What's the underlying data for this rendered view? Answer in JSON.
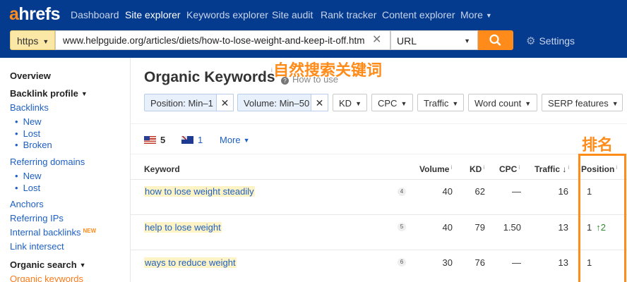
{
  "nav": {
    "logo_a": "a",
    "logo_rest": "hrefs",
    "items": [
      "Dashboard",
      "Site explorer",
      "Keywords explorer",
      "Site audit",
      "Rank tracker",
      "Content explorer",
      "More"
    ],
    "active": "Site explorer"
  },
  "search": {
    "protocol": "https",
    "url": "www.helpguide.org/articles/diets/how-to-lose-weight-and-keep-it-off.htm",
    "mode": "URL",
    "settings_label": "Settings"
  },
  "sidebar": {
    "overview": "Overview",
    "backlink_profile": "Backlink profile",
    "backlinks": "Backlinks",
    "bl_new": "New",
    "bl_lost": "Lost",
    "bl_broken": "Broken",
    "referring_domains": "Referring domains",
    "rd_new": "New",
    "rd_lost": "Lost",
    "anchors": "Anchors",
    "referring_ips": "Referring IPs",
    "internal_backlinks": "Internal backlinks",
    "new_badge": "NEW",
    "link_intersect": "Link intersect",
    "organic_search": "Organic search",
    "organic_keywords": "Organic keywords"
  },
  "main": {
    "title": "Organic Keywords",
    "info_mark": "i",
    "how_to_use": "How to use",
    "annotation_title": "自然搜索关键词",
    "annotation_position": "排名",
    "filters": {
      "position": "Position: Min–1",
      "volume": "Volume: Min–50",
      "kd": "KD",
      "cpc": "CPC",
      "traffic": "Traffic",
      "word_count": "Word count",
      "serp_features": "SERP features"
    },
    "countries": {
      "us_count": "5",
      "au_count": "1",
      "more": "More"
    },
    "columns": {
      "keyword": "Keyword",
      "volume": "Volume",
      "kd": "KD",
      "cpc": "CPC",
      "traffic": "Traffic",
      "position": "Position",
      "info": "i"
    },
    "rows": [
      {
        "keyword": "how to lose weight steadily",
        "serp": "4",
        "volume": "40",
        "kd": "62",
        "cpc": "—",
        "traffic": "16",
        "position": "1",
        "change": ""
      },
      {
        "keyword": "help to lose weight",
        "serp": "5",
        "volume": "40",
        "kd": "79",
        "cpc": "1.50",
        "traffic": "13",
        "position": "1",
        "change": "↑2"
      },
      {
        "keyword": "ways to reduce weight",
        "serp": "6",
        "volume": "30",
        "kd": "76",
        "cpc": "—",
        "traffic": "13",
        "position": "1",
        "change": ""
      }
    ]
  },
  "colors": {
    "nav_bg": "#053b8f",
    "accent": "#ff8c1a",
    "link": "#1d5fc4",
    "highlight": "#fdf3c4",
    "up": "#2e8b2e"
  }
}
